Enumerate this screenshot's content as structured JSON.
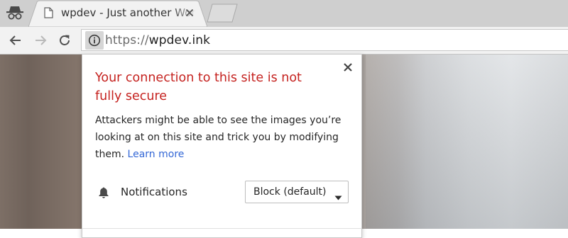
{
  "browser": {
    "tab": {
      "title": "wpdev - Just another WordPress site",
      "close_icon": "close-icon"
    },
    "incognito_icon": "incognito-icon",
    "new_tab_icon": "new-tab-icon"
  },
  "toolbar": {
    "back_icon": "back-arrow-icon",
    "forward_icon": "forward-arrow-icon",
    "reload_icon": "reload-icon",
    "omnibox": {
      "site_info_icon": "info-icon",
      "url_scheme": "https://",
      "url_host": "wpdev.ink"
    }
  },
  "popup": {
    "title": "Your connection to this site is not fully secure",
    "body": "Attackers might be able to see the images you’re looking at on this site and trick you by modifying them.",
    "learn_more": "Learn more",
    "permission": {
      "icon": "bell-icon",
      "label": "Notifications",
      "selected": "Block (default)"
    }
  },
  "colors": {
    "warning_title": "#c5221f",
    "link": "#3367d6",
    "tabstrip": "#cfcfcf",
    "toolbar": "#f2f2f2"
  }
}
